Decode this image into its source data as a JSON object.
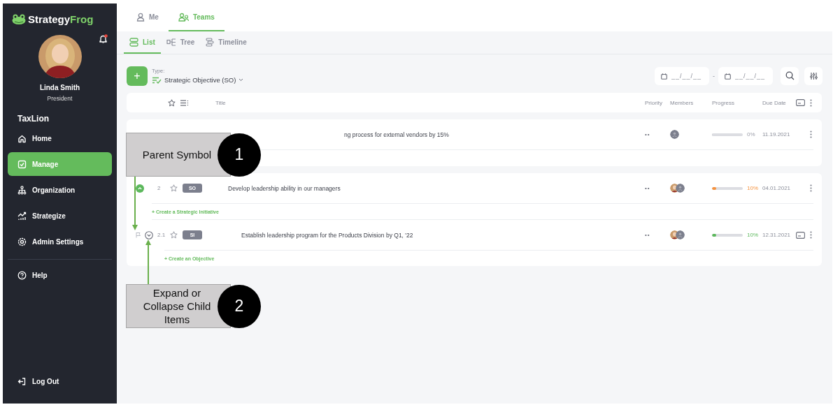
{
  "sidebar": {
    "logo": {
      "first": "Strategy",
      "second": "Frog"
    },
    "notifications": {
      "unread": true
    },
    "user": {
      "name": "Linda Smith",
      "role": "President"
    },
    "organization": "TaxLion",
    "nav": [
      {
        "label": "Home",
        "selected": false
      },
      {
        "label": "Manage",
        "selected": true
      },
      {
        "label": "Organization",
        "selected": false
      },
      {
        "label": "Strategize",
        "selected": false
      },
      {
        "label": "Admin Settings",
        "selected": false
      }
    ],
    "secondary": [
      {
        "label": "Help",
        "selected": false
      }
    ],
    "logout": "Log Out"
  },
  "tabs": [
    {
      "label": "Me",
      "selected": false
    },
    {
      "label": "Teams",
      "selected": true
    }
  ],
  "view_tabs": [
    {
      "label": "List",
      "selected": true
    },
    {
      "label": "Tree",
      "selected": false
    },
    {
      "label": "Timeline",
      "selected": false
    }
  ],
  "toolbar": {
    "add": "+",
    "type_label": "Type:",
    "type_value": "Strategic Objective (SO)",
    "date_from": {
      "placeholder": "__/__/__"
    },
    "date_separator": "-",
    "date_to": {
      "placeholder": "__/__/__"
    }
  },
  "table": {
    "columns": [
      "Title",
      "Priority",
      "Members",
      "Progress",
      "Due Date"
    ],
    "groups": [
      {
        "rows": [
          {
            "obscured": true,
            "title": "ng process for external vendors by 15%",
            "priority": "••",
            "members": [
              {
                "kind": "placeholder"
              }
            ],
            "level": 0,
            "percent": "0%",
            "due": "11.19.2021",
            "comment": false
          }
        ]
      },
      {
        "rows": [
          {
            "number": "2",
            "badge": "SO",
            "title": "Develop leadership ability in our managers",
            "expanded": true,
            "priority": "••",
            "members": [
              {
                "kind": "photo"
              },
              {
                "kind": "placeholder"
              }
            ],
            "level": 0.1,
            "percent": "10%",
            "color": "#f5923e",
            "due": "04.01.2021",
            "comment": false,
            "create": "+ Create a Strategic Initiative",
            "children": [
              {
                "number": "2.1",
                "badge": "SI",
                "title": "Establish leadership program for the Products Division by Q1, '22",
                "expanded": false,
                "priority": "••",
                "members": [
                  {
                    "kind": "photo"
                  },
                  {
                    "kind": "placeholder"
                  }
                ],
                "level": 0.1,
                "percent": "10%",
                "color": "#5cb85c",
                "due": "12.31.2021",
                "comment": true,
                "create": "+ Create an Objective"
              }
            ]
          }
        ]
      }
    ]
  },
  "callouts": [
    {
      "text": "Parent Symbol",
      "number": "1"
    },
    {
      "text": "Expand or Collapse Child Items",
      "number": "2"
    }
  ]
}
